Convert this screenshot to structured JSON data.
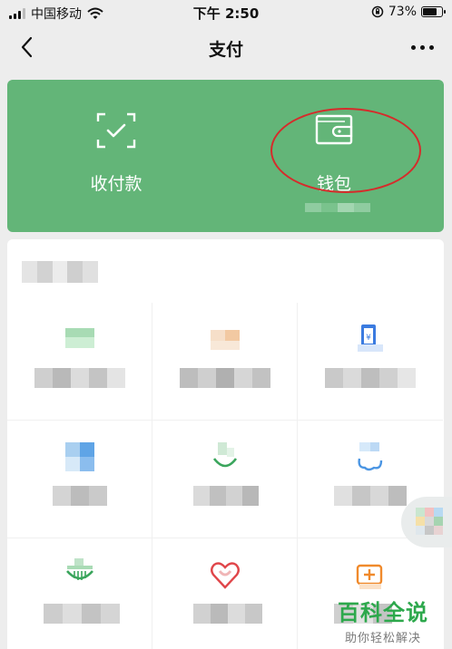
{
  "status_bar": {
    "carrier": "中国移动",
    "time": "下午 2:50",
    "battery": "73%",
    "battery_level": 0.73
  },
  "nav": {
    "title": "支付"
  },
  "wallet_card": {
    "actions": [
      {
        "label": "收付款",
        "icon": "scan-qr-icon"
      },
      {
        "label": "钱包",
        "icon": "wallet-icon"
      }
    ]
  },
  "services": {
    "items": [
      {
        "icon": "credit-card-icon",
        "label": ""
      },
      {
        "icon": "loan-icon",
        "label": ""
      },
      {
        "icon": "phone-recharge-icon",
        "label": ""
      },
      {
        "icon": "finance-icon",
        "label": ""
      },
      {
        "icon": "leaf-icon",
        "label": ""
      },
      {
        "icon": "cloud-icon",
        "label": ""
      },
      {
        "icon": "utility-icon",
        "label": ""
      },
      {
        "icon": "charity-heart-icon",
        "label": ""
      },
      {
        "icon": "medical-icon",
        "label": ""
      }
    ]
  },
  "watermark": {
    "title": "百科全说",
    "subtitle": "助你轻松解决"
  },
  "colors": {
    "accent_green": "#63b578",
    "annotation_red": "#d62b2b",
    "watermark_green": "#2da84c"
  }
}
